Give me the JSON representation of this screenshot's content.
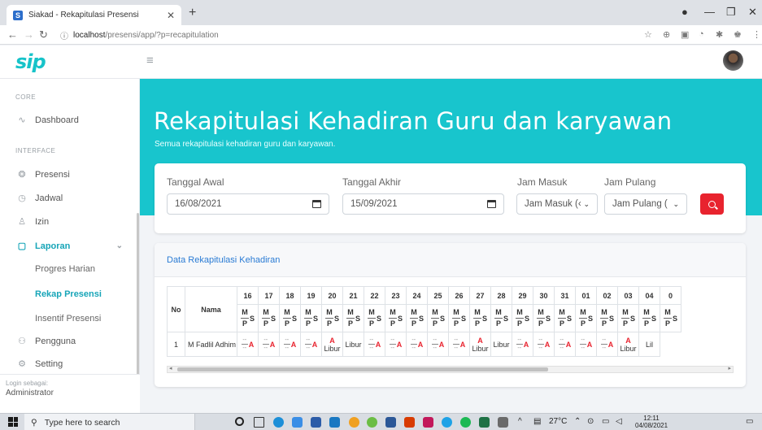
{
  "browser": {
    "tab_title": "Siakad - Rekapitulasi Presensi",
    "favicon_letter": "S",
    "url_host": "localhost",
    "url_path": "/presensi/app/?p=recapitulation"
  },
  "app": {
    "logo": "sip"
  },
  "sidebar": {
    "core_heading": "CORE",
    "interface_heading": "INTERFACE",
    "items": [
      {
        "label": "Dashboard",
        "icon": "activity-icon"
      },
      {
        "label": "Presensi",
        "icon": "fingerprint-icon"
      },
      {
        "label": "Jadwal",
        "icon": "clock-icon"
      },
      {
        "label": "Izin",
        "icon": "user-x-icon"
      },
      {
        "label": "Laporan",
        "icon": "clipboard-icon"
      },
      {
        "label": "Pengguna",
        "icon": "users-icon"
      },
      {
        "label": "Setting",
        "icon": "settings-icon"
      }
    ],
    "sub_items": [
      "Progres Harian",
      "Rekap Presensi",
      "Insentif Presensi"
    ],
    "login_label": "Login sebagai:",
    "login_role": "Administrator"
  },
  "hero": {
    "title": "Rekapitulasi Kehadiran Guru dan karyawan",
    "subtitle": "Semua rekapitulasi kehadiran guru dan karyawan."
  },
  "filters": {
    "tanggal_awal_label": "Tanggal Awal",
    "tanggal_awal_value": "16/08/2021",
    "tanggal_akhir_label": "Tanggal Akhir",
    "tanggal_akhir_value": "15/09/2021",
    "jam_masuk_label": "Jam Masuk",
    "jam_masuk_value": "Jam Masuk (‹",
    "jam_pulang_label": "Jam Pulang",
    "jam_pulang_value": "Jam Pulang (",
    "search_icon": "search-icon"
  },
  "table": {
    "card_title": "Data Rekapitulasi Kehadiran",
    "col_no": "No",
    "col_nama": "Nama",
    "days": [
      "16",
      "17",
      "18",
      "19",
      "20",
      "21",
      "22",
      "23",
      "24",
      "25",
      "26",
      "27",
      "28",
      "29",
      "30",
      "31",
      "01",
      "02",
      "03",
      "04",
      "0"
    ],
    "sub_m": "M",
    "sub_s": "S",
    "sub_p": "P",
    "rows": [
      {
        "no": "1",
        "nama": "M Fadlil Adhim",
        "cells": [
          "A",
          "A",
          "A",
          "A",
          "A Libur",
          "Libur",
          "A",
          "A",
          "A",
          "A",
          "A",
          "A Libur",
          "Libur",
          "A",
          "A",
          "A",
          "A",
          "A",
          "A Libur",
          "Lil"
        ]
      }
    ]
  },
  "taskbar": {
    "search_placeholder": "Type here to search",
    "temperature": "27°C",
    "time": "12:11",
    "date": "04/08/2021"
  }
}
